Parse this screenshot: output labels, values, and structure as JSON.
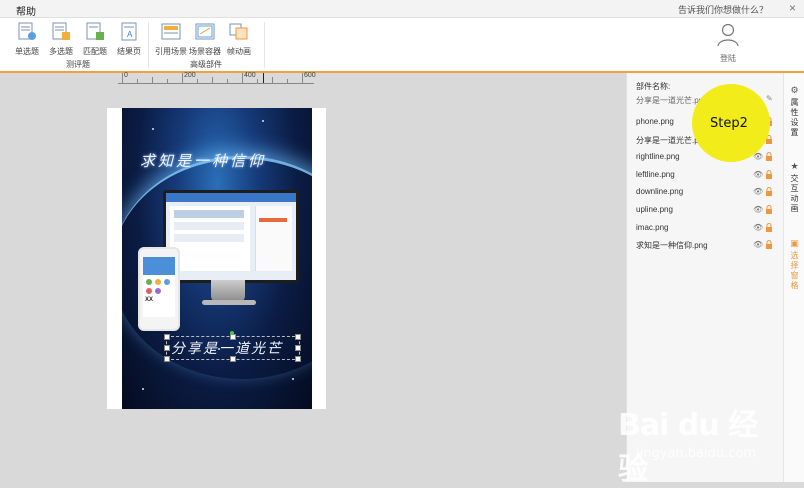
{
  "menubar": {
    "help": "帮助",
    "feedback": "告诉我们你想做什么？",
    "close": "×"
  },
  "ribbon": {
    "groups": [
      {
        "label": "测评题",
        "tools": [
          "单选题",
          "多选题",
          "匹配题",
          "结果页"
        ]
      },
      {
        "label": "高级部件",
        "tools": [
          "引用场景",
          "场景容器",
          "帧动画"
        ]
      }
    ],
    "login": "登陆"
  },
  "ruler": {
    "labels": [
      "0",
      "200",
      "400",
      "600"
    ]
  },
  "canvas": {
    "title_text": "求知是一种信仰",
    "subtitle_text": "分享是一道光芒",
    "phone_logo": "XX"
  },
  "layers": {
    "header": "部件名称:",
    "name_value": "分享是一道光芒.png",
    "items": [
      "phone.png",
      "分享是一道光芒.png",
      "rightline.png",
      "leftline.png",
      "downline.png",
      "upline.png",
      "imac.png",
      "求知是一种信仰.png"
    ]
  },
  "overlay": {
    "step_label": "Step2"
  },
  "right_tabs": [
    {
      "icon": "gear-icon",
      "label": "属性设置"
    },
    {
      "icon": "star-icon",
      "label": "交互动画"
    },
    {
      "icon": "layers-icon",
      "label": "选择窗格"
    }
  ],
  "watermark": {
    "logo": "Bai du 经验",
    "url": "jingyan.baidu.com"
  },
  "colors": {
    "accent": "#f0a040",
    "step_badge": "#f2ec1a",
    "canvas_bg": "#0b1c44"
  }
}
